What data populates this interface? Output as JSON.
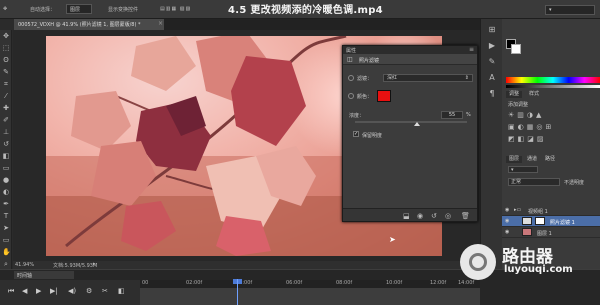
{
  "video_title": "4.5 更改视频添的冷暖色调.mp4",
  "options_bar": {
    "auto_select_label": "自动选择：",
    "auto_select_value": "图层",
    "transform_label": "显示变换控件"
  },
  "document": {
    "tab_label": "000572_VDXH @ 41.9% (照片滤镜 1, 图层蒙版/8) *",
    "zoom": "41.94%",
    "doc_size": "文档:5.93M/5.93M"
  },
  "properties_panel": {
    "title": "属性",
    "header_label": "照片滤镜",
    "filter_label": "滤镜：",
    "filter_value": "深红",
    "color_label": "颜色：",
    "color_value": "#e81010",
    "density_label": "浓度：",
    "density_value": "55",
    "density_unit": "%",
    "density_fraction": 0.55,
    "preserve_luminosity_label": "保留明度",
    "preserve_luminosity_checked": true
  },
  "timeline": {
    "tab_label": "时间轴",
    "ticks": [
      "00",
      "02:00f",
      "04:00f",
      "06:00f",
      "08:00f",
      "10:00f",
      "12:00f",
      "14:00f"
    ]
  },
  "right_panels": {
    "adjust_tabs": [
      "调整",
      "样式"
    ],
    "adjust_title": "添加调整",
    "layers_tabs": [
      "图层",
      "通道",
      "路径"
    ],
    "blend_mode": "正常",
    "opacity_label": "不透明度",
    "layers": [
      {
        "name": "视频组 1"
      },
      {
        "name": "照片滤镜 1"
      },
      {
        "name": "图层 1"
      }
    ]
  },
  "watermark": {
    "title": "路由器",
    "subtitle": "luyouqi.com"
  }
}
